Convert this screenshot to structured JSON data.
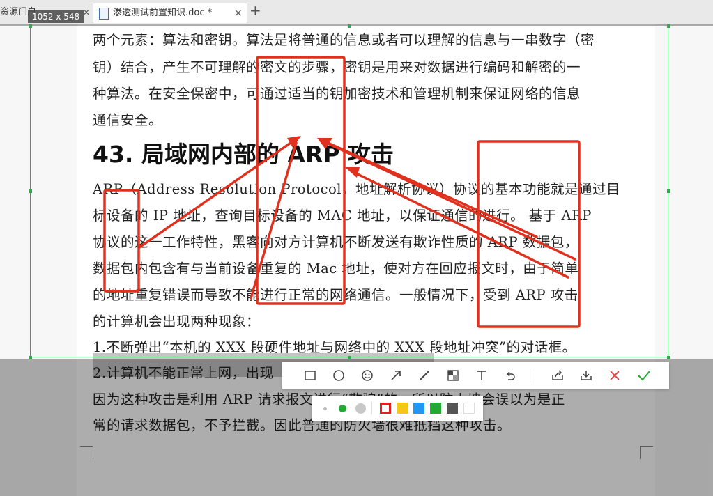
{
  "tabs": [
    {
      "label": "资源门户",
      "close": "×"
    },
    {
      "label": "渗透测试前置知识.doc *",
      "close": "×"
    }
  ],
  "new_tab": "+",
  "size_badge": "1052 x 548",
  "document": {
    "lines": [
      "两个元素：算法和密钥。算法是将普通的信息或者可以理解的信息与一串数字（密",
      "钥）结合，产生不可理解的密文的步骤，密钥是用来对数据进行编码和解密的一",
      "种算法。在安全保密中，可通过适当的钥加密技术和管理机制来保证网络的信息",
      "通信安全。",
      "43.  局域网内部的 ARP 攻击",
      "ARP（Address Resolution Protocol，地址解析协议）协议的基本功能就是通过目",
      "标设备的 IP 地址，查询目标设备的 MAC 地址，以保证通信的进行。 基于 ARP",
      "协议的这一工作特性，黑客向对方计算机不断发送有欺诈性质的 ARP 数据包，",
      "数据包内包含有与当前设备重复的 Mac 地址，使对方在回应报文时，由于简单",
      "的地址重复错误而导致不能进行正常的网络通信。一般情况下，受到 ARP 攻击",
      "的计算机会出现两种现象：",
      "1.不断弹出“本机的 XXX 段硬件地址与网络中的 XXX 段地址冲突”的对话框。",
      "2.计算机不能正常上网，出现",
      "因为这种攻击是利用 ARP 请求报文进行“欺骗”的，所以防火墙会误以为是正",
      "常的请求数据包，不予拦截。因此普通的防火墙很难抵挡这种攻击。"
    ]
  },
  "toolbar": {
    "tools": [
      "rectangle-icon",
      "ellipse-icon",
      "emoji-icon",
      "arrow-icon",
      "pen-icon",
      "mosaic-icon",
      "text-icon",
      "undo-icon",
      "share-icon",
      "download-icon",
      "cancel-icon",
      "confirm-icon"
    ]
  },
  "palette": {
    "sizes": [
      "small",
      "medium",
      "large"
    ],
    "colors": [
      "#e02020",
      "#f5c518",
      "#2196f3",
      "#22aa33",
      "#555555",
      "#ffffff"
    ],
    "selected_color": "#e02020",
    "selected_size": "medium"
  },
  "annotation_color": "#e0301e",
  "selection_color": "#2fa84f"
}
